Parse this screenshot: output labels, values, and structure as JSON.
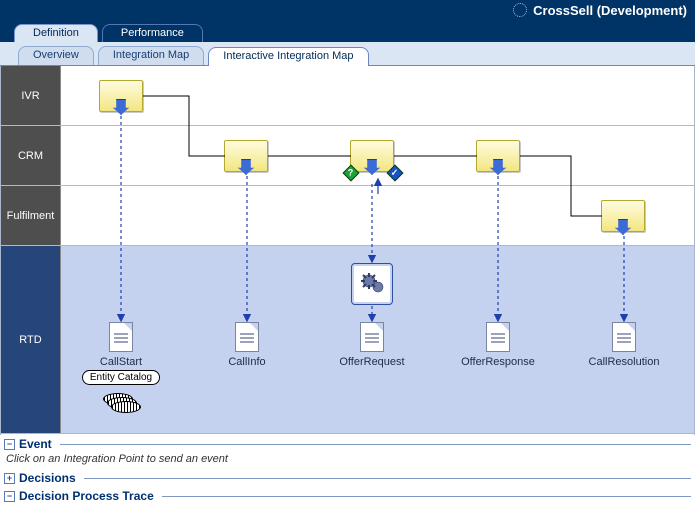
{
  "app": {
    "title": "CrossSell (Development)"
  },
  "top_tabs": {
    "definition": "Definition",
    "performance": "Performance"
  },
  "sub_tabs": {
    "overview": "Overview",
    "integration_map": "Integration Map",
    "interactive": "Interactive Integration Map"
  },
  "lanes": {
    "ivr": "IVR",
    "crm": "CRM",
    "fulfilment": "Fulfilment",
    "rtd": "RTD"
  },
  "columns": {
    "c0": "CallStart",
    "c1": "CallInfo",
    "c2": "OfferRequest",
    "c3": "OfferResponse",
    "c4": "CallResolution"
  },
  "entity_catalog": "Entity Catalog",
  "panels": {
    "event": {
      "title": "Event",
      "hint": "Click on an Integration Point to send an event",
      "state": "−"
    },
    "decisions": {
      "title": "Decisions",
      "state": "+"
    },
    "trace": {
      "title": "Decision Process Trace",
      "state": "−"
    }
  }
}
